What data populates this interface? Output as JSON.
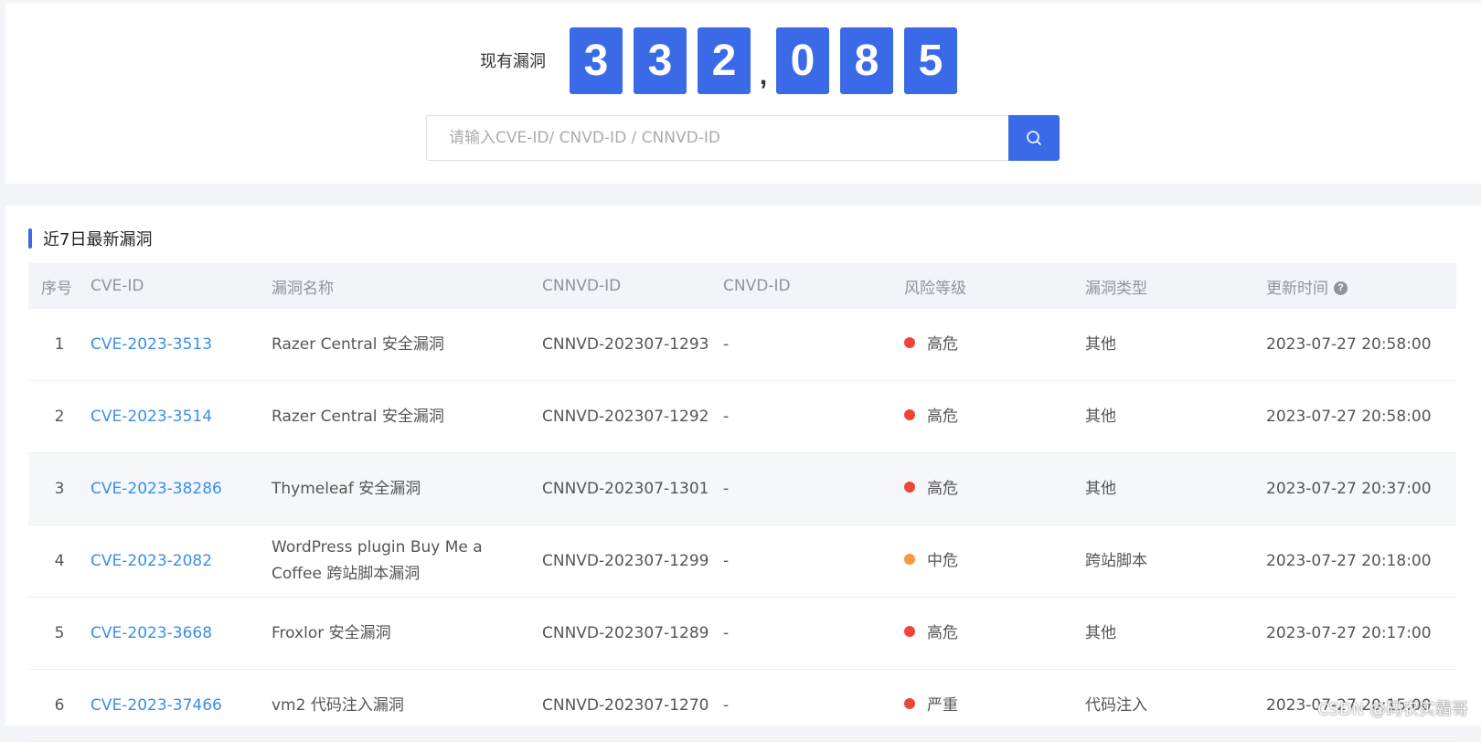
{
  "counter": {
    "label": "现有漏洞",
    "digits": [
      "3",
      "3",
      "2",
      ",",
      "0",
      "8",
      "5"
    ]
  },
  "search": {
    "placeholder": "请输入CVE-ID/ CNVD-ID / CNNVD-ID",
    "icon": "search-icon"
  },
  "section": {
    "title": "近7日最新漏洞"
  },
  "table": {
    "columns": [
      "序号",
      "CVE-ID",
      "漏洞名称",
      "CNNVD-ID",
      "CNVD-ID",
      "风险等级",
      "漏洞类型",
      "更新时间"
    ],
    "rows": [
      {
        "idx": "1",
        "cve": "CVE-2023-3513",
        "name": "Razer Central 安全漏洞",
        "cnnvd": "CNNVD-202307-1293",
        "cnvd": "-",
        "severity": "高危",
        "sev_color": "#f04438",
        "type": "其他",
        "time": "2023-07-27 20:58:00"
      },
      {
        "idx": "2",
        "cve": "CVE-2023-3514",
        "name": "Razer Central 安全漏洞",
        "cnnvd": "CNNVD-202307-1292",
        "cnvd": "-",
        "severity": "高危",
        "sev_color": "#f04438",
        "type": "其他",
        "time": "2023-07-27 20:58:00"
      },
      {
        "idx": "3",
        "cve": "CVE-2023-38286",
        "name": "Thymeleaf 安全漏洞",
        "cnnvd": "CNNVD-202307-1301",
        "cnvd": "-",
        "severity": "高危",
        "sev_color": "#f04438",
        "type": "其他",
        "time": "2023-07-27 20:37:00"
      },
      {
        "idx": "4",
        "cve": "CVE-2023-2082",
        "name": "WordPress plugin Buy Me a Coffee 跨站脚本漏洞",
        "cnnvd": "CNNVD-202307-1299",
        "cnvd": "-",
        "severity": "中危",
        "sev_color": "#f79a3b",
        "type": "跨站脚本",
        "time": "2023-07-27 20:18:00"
      },
      {
        "idx": "5",
        "cve": "CVE-2023-3668",
        "name": "Froxlor 安全漏洞",
        "cnnvd": "CNNVD-202307-1289",
        "cnvd": "-",
        "severity": "高危",
        "sev_color": "#f04438",
        "type": "其他",
        "time": "2023-07-27 20:17:00"
      },
      {
        "idx": "6",
        "cve": "CVE-2023-37466",
        "name": "vm2 代码注入漏洞",
        "cnnvd": "CNNVD-202307-1270",
        "cnvd": "-",
        "severity": "严重",
        "sev_color": "#f04438",
        "type": "代码注入",
        "time": "2023-07-27 20:15:00"
      }
    ]
  },
  "watermark": "CSDN @码农实霸哥",
  "colors": {
    "accent": "#3a6ae8",
    "link": "#3a8ee6"
  }
}
